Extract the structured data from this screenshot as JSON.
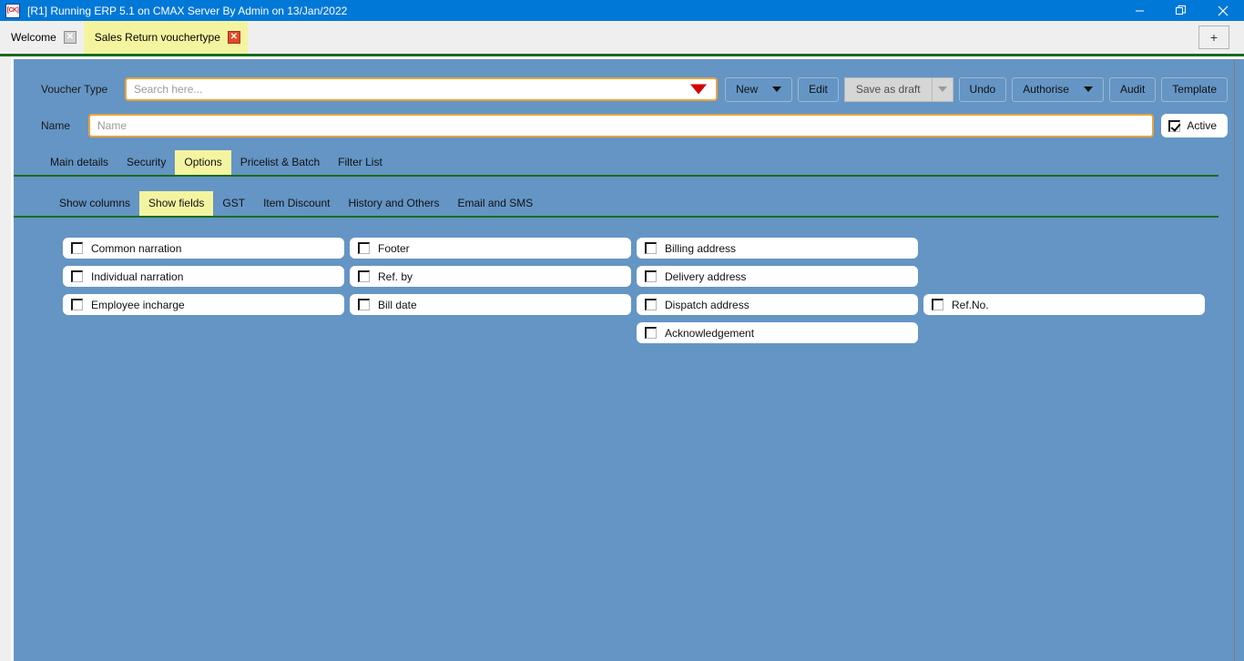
{
  "window": {
    "title": "[R1] Running ERP 5.1 on CMAX Server By Admin on 13/Jan/2022",
    "app_icon": "[CK]",
    "icon_name": "app-icon",
    "minimize": "—",
    "maximize": "❐",
    "close": "✕",
    "accent": "#0078d7"
  },
  "tabstrip": {
    "tabs": [
      {
        "label": "Welcome",
        "active": false,
        "close": "✕"
      },
      {
        "label": "Sales Return vouchertype",
        "active": true,
        "close": "✕"
      }
    ],
    "new_tab": "+",
    "new_tab_name": "new-tab-button",
    "highlight_color": "#f4f4a0"
  },
  "form": {
    "voucher_type_label": "Voucher Type",
    "voucher_type_placeholder": "Search here...",
    "voucher_type_value": "",
    "name_label": "Name",
    "name_placeholder": "Name",
    "name_value": "",
    "active_label": "Active",
    "active_checked": true,
    "field_border_color": "#e8a33d",
    "dropdown_caret_color": "#d40000"
  },
  "toolbar": {
    "new_label": "New",
    "edit_label": "Edit",
    "save_as_draft_label": "Save as draft",
    "save_as_draft_disabled": true,
    "undo_label": "Undo",
    "authorise_label": "Authorise",
    "audit_label": "Audit",
    "template_label": "Template"
  },
  "main_tabs": {
    "items": [
      {
        "label": "Main details",
        "active": false
      },
      {
        "label": "Security",
        "active": false
      },
      {
        "label": "Options",
        "active": true
      },
      {
        "label": "Pricelist & Batch",
        "active": false
      },
      {
        "label": "Filter List",
        "active": false
      }
    ]
  },
  "sub_tabs": {
    "items": [
      {
        "label": "Show columns",
        "active": false
      },
      {
        "label": "Show fields",
        "active": true
      },
      {
        "label": "GST",
        "active": false
      },
      {
        "label": "Item Discount",
        "active": false
      },
      {
        "label": "History and Others",
        "active": false
      },
      {
        "label": "Email and SMS",
        "active": false
      }
    ]
  },
  "show_fields": {
    "rows": [
      [
        {
          "label": "Common narration",
          "checked": false
        },
        {
          "label": "Footer",
          "checked": false
        },
        {
          "label": "Billing address",
          "checked": false
        },
        null
      ],
      [
        {
          "label": "Individual narration",
          "checked": false
        },
        {
          "label": "Ref. by",
          "checked": false
        },
        {
          "label": "Delivery address",
          "checked": false
        },
        null
      ],
      [
        {
          "label": "Employee incharge",
          "checked": false
        },
        {
          "label": "Bill date",
          "checked": false
        },
        {
          "label": "Dispatch address",
          "checked": false
        },
        {
          "label": "Ref.No.",
          "checked": false
        }
      ],
      [
        null,
        null,
        {
          "label": "Acknowledgement",
          "checked": false
        },
        null
      ]
    ]
  },
  "theme": {
    "panel_blue": "#6495c4",
    "rule_green": "#1b6b1b",
    "chrome_grey": "#efefef"
  }
}
